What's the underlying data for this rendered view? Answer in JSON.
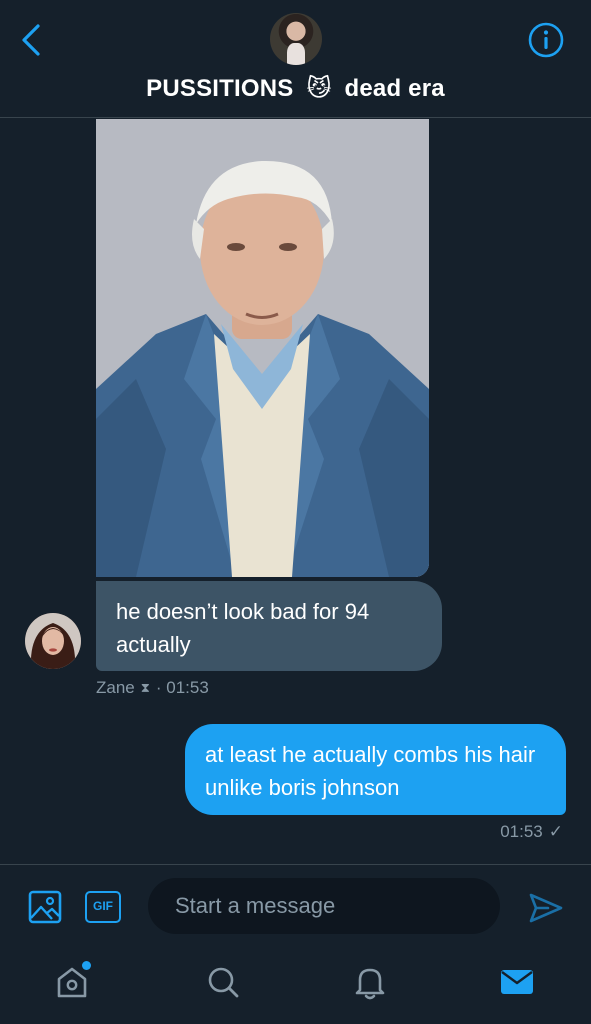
{
  "header": {
    "title_left": "PUSSITIONS",
    "title_emoji": "😼",
    "title_right": "dead era",
    "back_icon": "chevron-left-icon",
    "info_icon": "info-circle-icon"
  },
  "messages": [
    {
      "direction": "in",
      "text": "he doesn’t look bad for 94 actually",
      "sender": "Zane",
      "sender_badge": "⧗",
      "time": "· 01:53"
    },
    {
      "direction": "out",
      "text": "at least he actually combs his hair unlike boris johnson",
      "time": "01:53",
      "status": "✓"
    }
  ],
  "composer": {
    "placeholder": "Start a message",
    "gif_label": "GIF",
    "media_icon": "image-icon",
    "send_icon": "send-icon"
  },
  "tabbar": {
    "items": [
      "home-icon",
      "search-icon",
      "notifications-icon",
      "messages-icon"
    ],
    "active": "messages-icon"
  },
  "colors": {
    "background": "#15202b",
    "accent": "#1da1f2",
    "incoming_bubble": "#3d5466",
    "muted_text": "#8899a6",
    "divider": "#38444d"
  }
}
